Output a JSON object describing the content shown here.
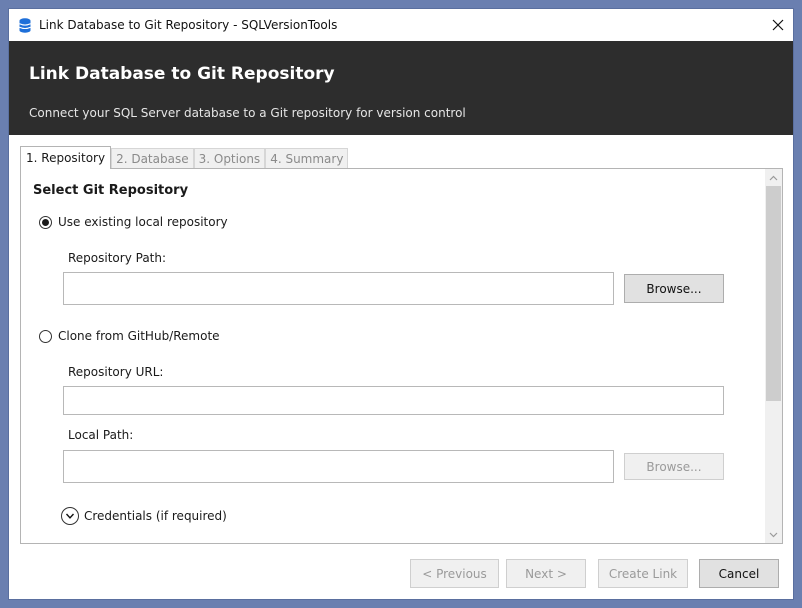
{
  "window": {
    "title": "Link Database to Git Repository - SQLVersionTools",
    "close_label": "✕"
  },
  "header": {
    "title": "Link Database to Git Repository",
    "subtitle": "Connect your SQL Server database to a Git repository for version control"
  },
  "tabs": [
    {
      "label": "1. Repository",
      "active": true
    },
    {
      "label": "2. Database",
      "active": false
    },
    {
      "label": "3. Options",
      "active": false
    },
    {
      "label": "4. Summary",
      "active": false
    }
  ],
  "repository": {
    "section_title": "Select Git Repository",
    "option_local": {
      "label": "Use existing local repository",
      "checked": true
    },
    "repo_path": {
      "label": "Repository Path:",
      "value": "",
      "placeholder": ""
    },
    "browse_label": "Browse...",
    "option_clone": {
      "label": "Clone from GitHub/Remote",
      "checked": false
    },
    "repo_url": {
      "label": "Repository URL:",
      "value": "",
      "placeholder": ""
    },
    "local_path": {
      "label": "Local Path:",
      "value": "",
      "placeholder": ""
    },
    "browse_disabled_label": "Browse...",
    "credentials_label": "Credentials (if required)"
  },
  "footer": {
    "previous_label": "< Previous",
    "next_label": "Next >",
    "create_label": "Create Link",
    "cancel_label": "Cancel"
  },
  "icons": {
    "app": "database-icon",
    "close": "close-icon",
    "credentials": "chevron-down-icon",
    "scroll_up": "scroll-up-arrow-icon",
    "scroll_down": "scroll-down-arrow-icon"
  },
  "colors": {
    "header_bg": "#2d2d2d",
    "app_icon": "#1e6fd9",
    "desktop": "#6a7fb0"
  }
}
